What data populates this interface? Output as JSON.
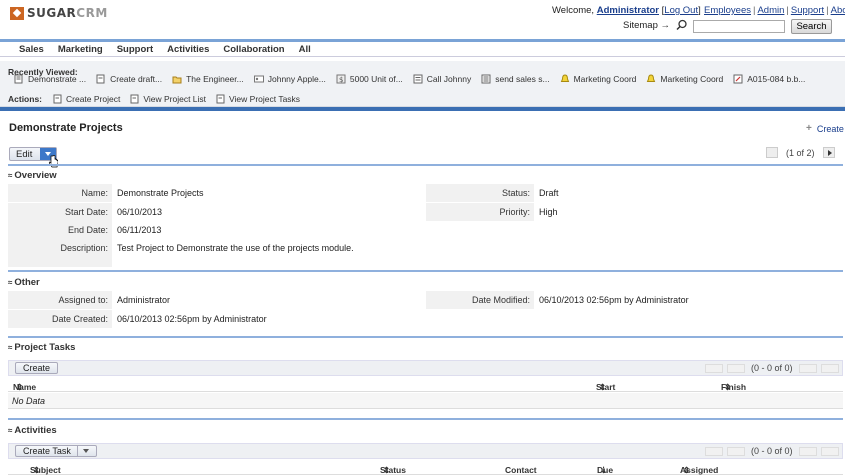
{
  "header": {
    "logo_primary": "SUGAR",
    "logo_secondary": "CRM",
    "welcome_prefix": "Welcome,",
    "user": "Administrator",
    "logout": "Log Out",
    "top_links": [
      "Employees",
      "Admin",
      "Support",
      "About"
    ],
    "sitemap": "Sitemap",
    "search_placeholder": "",
    "search_button": "Search"
  },
  "nav": {
    "tabs": [
      "Sales",
      "Marketing",
      "Support",
      "Activities",
      "Collaboration",
      "All"
    ]
  },
  "recently_viewed": {
    "label": "Recently Viewed:",
    "items": [
      {
        "label": "Demonstrate ...",
        "icon": "project-icon"
      },
      {
        "label": "Create draft...",
        "icon": "task-icon"
      },
      {
        "label": "The Engineer...",
        "icon": "folder-icon"
      },
      {
        "label": "Johnny Apple...",
        "icon": "contact-card-icon"
      },
      {
        "label": "5000 Unit of...",
        "icon": "opportunity-icon"
      },
      {
        "label": "Call Johnny",
        "icon": "call-icon"
      },
      {
        "label": "send sales s...",
        "icon": "email-icon"
      },
      {
        "label": "Marketing Coord",
        "icon": "bell-icon"
      },
      {
        "label": "Marketing Coord",
        "icon": "bell-icon"
      },
      {
        "label": "A015-084 b.b...",
        "icon": "case-icon"
      }
    ]
  },
  "actions": {
    "label": "Actions:",
    "items": [
      "Create Project",
      "View Project List",
      "View Project Tasks"
    ]
  },
  "detail": {
    "title": "Demonstrate Projects",
    "create_label": "Create",
    "edit_label": "Edit",
    "pager": "(1 of 2)"
  },
  "overview": {
    "heading": "Overview",
    "name_label": "Name:",
    "name_value": "Demonstrate Projects",
    "status_label": "Status:",
    "status_value": "Draft",
    "start_label": "Start Date:",
    "start_value": "06/10/2013",
    "priority_label": "Priority:",
    "priority_value": "High",
    "end_label": "End Date:",
    "end_value": "06/11/2013",
    "desc_label": "Description:",
    "desc_value": "Test Project to Demonstrate the use of the projects module."
  },
  "other": {
    "heading": "Other",
    "assigned_label": "Assigned to:",
    "assigned_value": "Administrator",
    "modified_label": "Date Modified:",
    "modified_value": "06/10/2013 02:56pm by Administrator",
    "created_label": "Date Created:",
    "created_value": "06/10/2013 02:56pm by Administrator"
  },
  "project_tasks": {
    "heading": "Project Tasks",
    "create_button": "Create",
    "pager": "(0 - 0 of 0)",
    "columns": [
      "Name",
      "Start Date:",
      "Finish Date:"
    ],
    "empty": "No Data"
  },
  "activities": {
    "heading": "Activities",
    "create_button": "Create Task",
    "pager": "(0 - 0 of 0)",
    "columns": [
      "Subject",
      "Status",
      "Contact",
      "Due Date",
      "Assigned User"
    ]
  }
}
